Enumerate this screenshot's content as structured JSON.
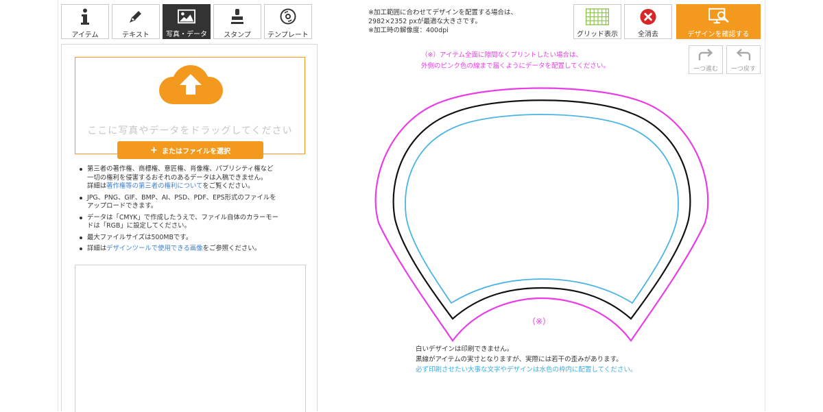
{
  "tabs": [
    {
      "label": "アイテム",
      "icon": "info-icon"
    },
    {
      "label": "テキスト",
      "icon": "pen-icon"
    },
    {
      "label": "写真・データ",
      "icon": "image-icon",
      "active": true
    },
    {
      "label": "スタンプ",
      "icon": "stamp-icon"
    },
    {
      "label": "テンプレート",
      "icon": "disc-icon"
    }
  ],
  "upload": {
    "drop_text": "ここに写真やデータをドラッグしてください",
    "button_label": "またはファイルを選択",
    "accent_color": "#f39a1e"
  },
  "notes": {
    "n1_line1": "第三者の著作権、商標権、意匠権、肖像権、パブリシティ権など",
    "n1_line2": "一切の権利を侵害するおそれのあるデータは入稿できません。",
    "n1_pre": "詳細は",
    "n1_link": "著作権等の第三者の権利について",
    "n1_post": "をご覧ください。",
    "n2_line1": "JPG、PNG、GIF、BMP、AI、PSD、PDF、EPS形式のファイルを",
    "n2_line2": "アップロードできます。",
    "n3_line1": "データは「CMYK」で作成したうえで、ファイル自体のカラーモー",
    "n3_line2": "ドは「RGB」に設定してください。",
    "n4": "最大ファイルサイズは500MBです。",
    "n5_pre": "詳細は",
    "n5_link": "デザインツールで使用できる画像",
    "n5_post": "をご参照ください。"
  },
  "info": {
    "line1": "※加工範囲に合わせてデザインを配置する場合は、",
    "line2": "2982×2352 pxが最適な大きさです。",
    "line3": "※加工時の解像度：400dpi"
  },
  "toolbar": {
    "grid_label": "グリッド表示",
    "clear_label": "全消去",
    "confirm_label": "デザインを確認する",
    "redo_label": "一つ進む",
    "undo_label": "一つ戻す"
  },
  "canvas": {
    "pink_note_line1": "（※）アイテム全面に隙間なくプリントしたい場合は、",
    "pink_note_line2": "外側のピンク色の線まで届くようにデータを配置してください。",
    "mark": "（※）",
    "bottom_line1": "白いデザインは印刷できません。",
    "bottom_line2": "黒線がアイテムの実寸となりますが、実際には若干の歪みがあります。",
    "bottom_line3": "必ず印刷させたい大事な文字やデザインは水色の枠内に配置してください。",
    "colors": {
      "bleed": "#e83ce6",
      "cut": "#111111",
      "safe": "#4ab3e6"
    }
  }
}
